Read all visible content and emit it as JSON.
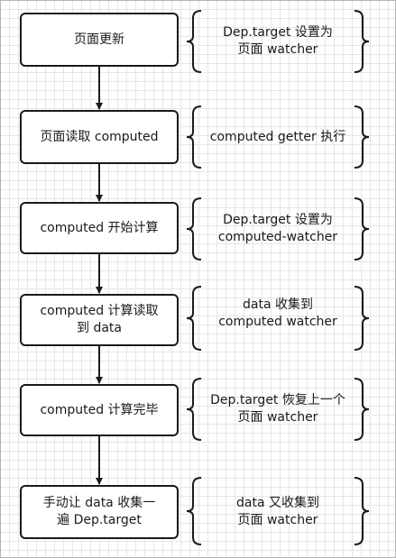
{
  "steps": [
    {
      "label": "页面更新"
    },
    {
      "label": "页面读取 computed"
    },
    {
      "label": "computed 开始计算"
    },
    {
      "label": "computed 计算读取\n到 data"
    },
    {
      "label": "computed 计算完毕"
    },
    {
      "label": "手动让 data 收集一\n遍 Dep.target"
    }
  ],
  "notes": [
    {
      "label": "Dep.target 设置为\n页面 watcher"
    },
    {
      "label": "computed getter 执行"
    },
    {
      "label": "Dep.target 设置为\ncomputed-watcher"
    },
    {
      "label": "data 收集到\ncomputed watcher"
    },
    {
      "label": "Dep.target 恢复上一个\n页面 watcher"
    },
    {
      "label": "data 又收集到\n页面 watcher"
    }
  ],
  "colors": {
    "line": "#1a1a1a",
    "grid": "#e6e6e6"
  }
}
